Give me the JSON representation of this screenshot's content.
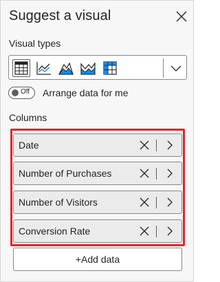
{
  "pane": {
    "title": "Suggest a visual",
    "close_icon": "close-icon"
  },
  "visual_types": {
    "label": "Visual types",
    "icons": [
      "table-icon",
      "line-chart-icon",
      "area-chart-icon",
      "stacked-area-chart-icon",
      "matrix-icon"
    ],
    "dropdown_icon": "chevron-down-icon"
  },
  "arrange": {
    "toggle_state": "Off",
    "label": "Arrange data for me"
  },
  "columns": {
    "label": "Columns",
    "fields": [
      {
        "label": "Date"
      },
      {
        "label": "Number of Purchases"
      },
      {
        "label": "Number of Visitors"
      },
      {
        "label": "Conversion Rate"
      }
    ],
    "highlight_color": "#e3242b"
  },
  "add_data": {
    "label": "+Add data"
  }
}
